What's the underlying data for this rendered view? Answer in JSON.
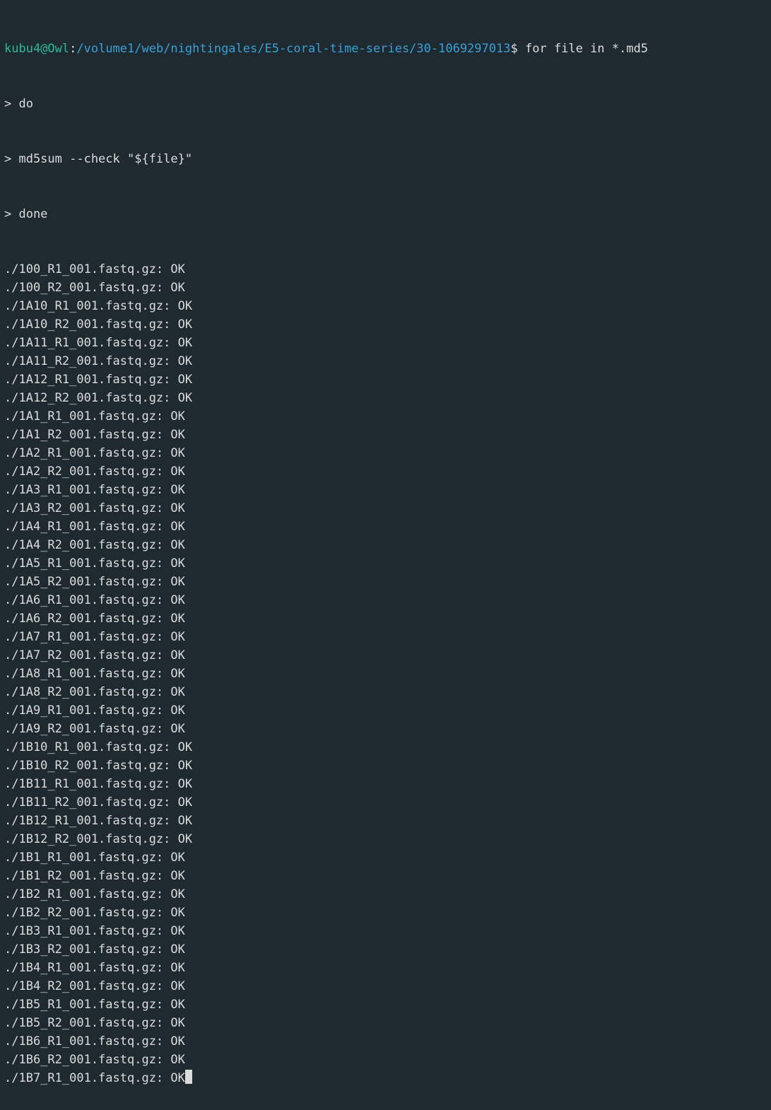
{
  "prompt": {
    "user_host": "kubu4@Owl",
    "colon": ":",
    "path": "/volume1/web/nightingales/E5-coral-time-series/30-1069297013",
    "dollar": "$ "
  },
  "command_lines": [
    "for file in *.md5",
    "> do",
    "> md5sum --check \"${file}\"",
    "> done"
  ],
  "output_lines": [
    "./100_R1_001.fastq.gz: OK",
    "./100_R2_001.fastq.gz: OK",
    "./1A10_R1_001.fastq.gz: OK",
    "./1A10_R2_001.fastq.gz: OK",
    "./1A11_R1_001.fastq.gz: OK",
    "./1A11_R2_001.fastq.gz: OK",
    "./1A12_R1_001.fastq.gz: OK",
    "./1A12_R2_001.fastq.gz: OK",
    "./1A1_R1_001.fastq.gz: OK",
    "./1A1_R2_001.fastq.gz: OK",
    "./1A2_R1_001.fastq.gz: OK",
    "./1A2_R2_001.fastq.gz: OK",
    "./1A3_R1_001.fastq.gz: OK",
    "./1A3_R2_001.fastq.gz: OK",
    "./1A4_R1_001.fastq.gz: OK",
    "./1A4_R2_001.fastq.gz: OK",
    "./1A5_R1_001.fastq.gz: OK",
    "./1A5_R2_001.fastq.gz: OK",
    "./1A6_R1_001.fastq.gz: OK",
    "./1A6_R2_001.fastq.gz: OK",
    "./1A7_R1_001.fastq.gz: OK",
    "./1A7_R2_001.fastq.gz: OK",
    "./1A8_R1_001.fastq.gz: OK",
    "./1A8_R2_001.fastq.gz: OK",
    "./1A9_R1_001.fastq.gz: OK",
    "./1A9_R2_001.fastq.gz: OK",
    "./1B10_R1_001.fastq.gz: OK",
    "./1B10_R2_001.fastq.gz: OK",
    "./1B11_R1_001.fastq.gz: OK",
    "./1B11_R2_001.fastq.gz: OK",
    "./1B12_R1_001.fastq.gz: OK",
    "./1B12_R2_001.fastq.gz: OK",
    "./1B1_R1_001.fastq.gz: OK",
    "./1B1_R2_001.fastq.gz: OK",
    "./1B2_R1_001.fastq.gz: OK",
    "./1B2_R2_001.fastq.gz: OK",
    "./1B3_R1_001.fastq.gz: OK",
    "./1B3_R2_001.fastq.gz: OK",
    "./1B4_R1_001.fastq.gz: OK",
    "./1B4_R2_001.fastq.gz: OK",
    "./1B5_R1_001.fastq.gz: OK",
    "./1B5_R2_001.fastq.gz: OK",
    "./1B6_R1_001.fastq.gz: OK",
    "./1B6_R2_001.fastq.gz: OK",
    "./1B7_R1_001.fastq.gz: OK"
  ]
}
